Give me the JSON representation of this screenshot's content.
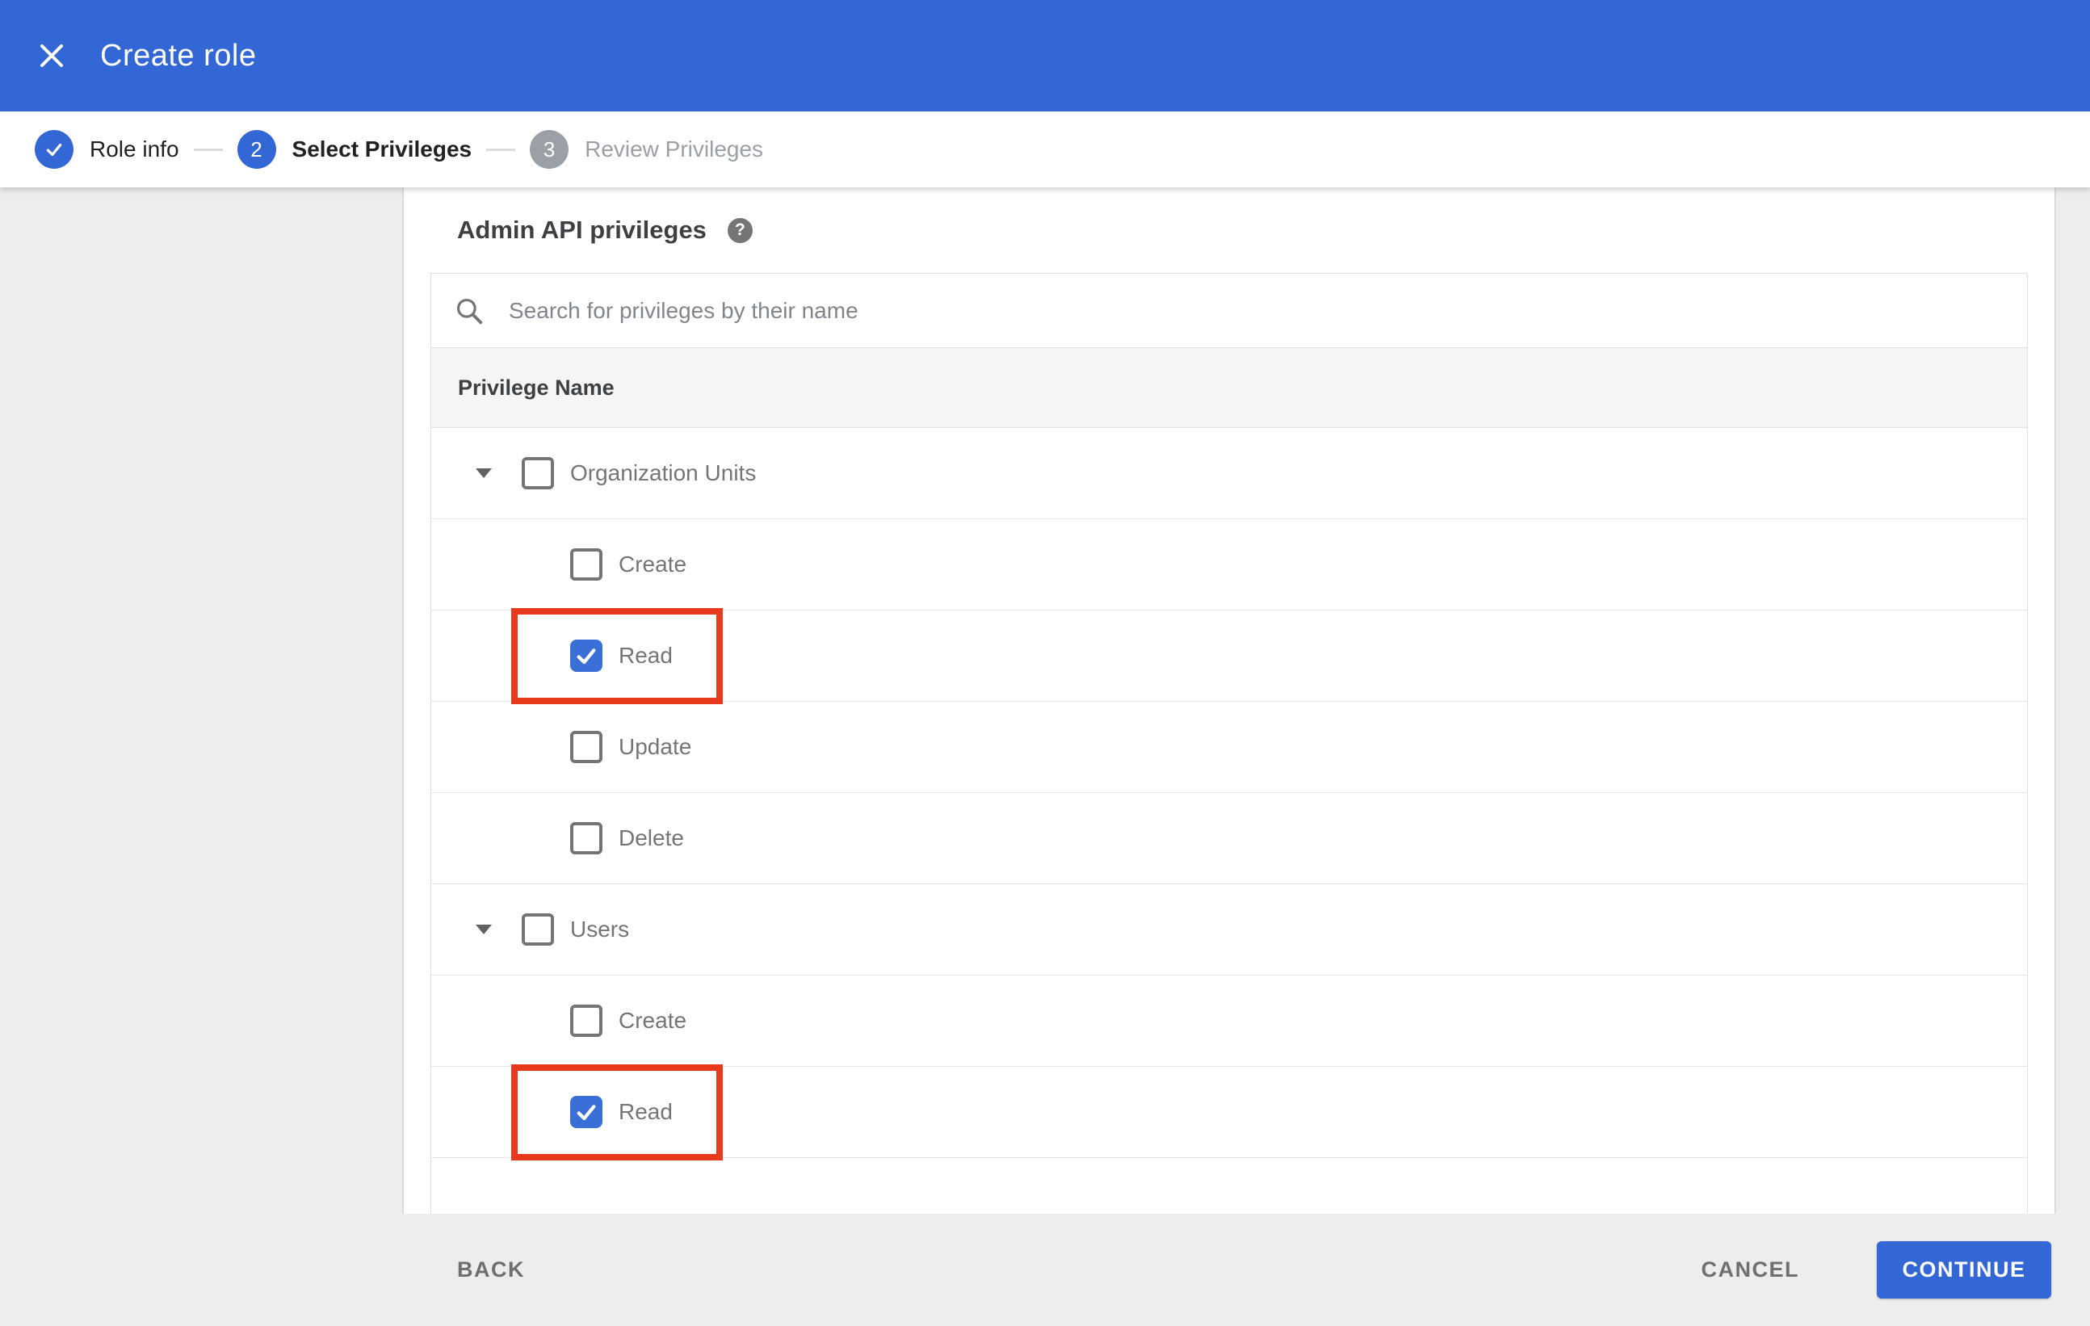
{
  "appbar": {
    "title": "Create role"
  },
  "stepper": {
    "steps": [
      {
        "label": "Role info",
        "state": "completed"
      },
      {
        "number": "2",
        "label": "Select Privileges",
        "state": "active"
      },
      {
        "number": "3",
        "label": "Review Privileges",
        "state": "upcoming"
      }
    ]
  },
  "panel": {
    "heading": "Admin API privileges",
    "help_icon": "question-mark",
    "search_placeholder": "Search for privileges by their name",
    "table_header": "Privilege Name",
    "groups": [
      {
        "label": "Organization Units",
        "checked": false,
        "expanded": true,
        "children": [
          {
            "label": "Create",
            "checked": false,
            "highlighted": false
          },
          {
            "label": "Read",
            "checked": true,
            "highlighted": true
          },
          {
            "label": "Update",
            "checked": false,
            "highlighted": false
          },
          {
            "label": "Delete",
            "checked": false,
            "highlighted": false
          }
        ]
      },
      {
        "label": "Users",
        "checked": false,
        "expanded": true,
        "children": [
          {
            "label": "Create",
            "checked": false,
            "highlighted": false
          },
          {
            "label": "Read",
            "checked": true,
            "highlighted": true
          }
        ]
      }
    ]
  },
  "footer": {
    "back_label": "BACK",
    "cancel_label": "CANCEL",
    "continue_label": "CONTINUE"
  },
  "colors": {
    "appbar_blue": "#3367d6",
    "accent": "#3367d6",
    "checkbox_blue": "#3b6fd8",
    "highlight_red": "#e8391d",
    "page_bg": "#ededed",
    "header_row_bg": "#f5f5f5"
  }
}
